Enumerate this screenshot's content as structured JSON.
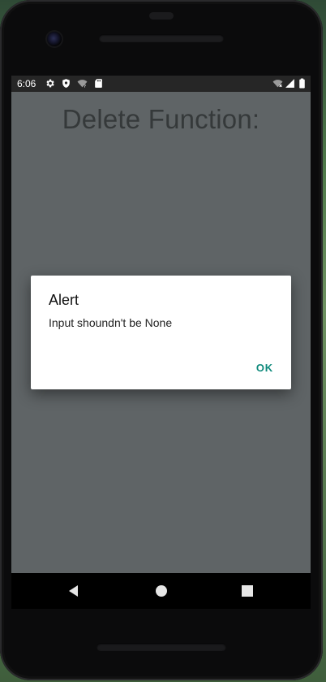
{
  "status_bar": {
    "time": "6:06",
    "left_icons": [
      "settings-icon",
      "shield-icon",
      "wifi-unknown-icon",
      "sd-card-icon"
    ],
    "right_icons": [
      "wifi-no-internet-icon",
      "cellular-signal-icon",
      "battery-icon"
    ]
  },
  "app": {
    "title": "Delete Function:",
    "background_color": "#5f6466"
  },
  "dialog": {
    "title": "Alert",
    "message": "Input shoundn't be None",
    "ok_label": "OK",
    "accent_color": "#0f8a7c"
  },
  "nav_bar": {
    "buttons": [
      "back-icon",
      "home-icon",
      "recents-icon"
    ]
  }
}
